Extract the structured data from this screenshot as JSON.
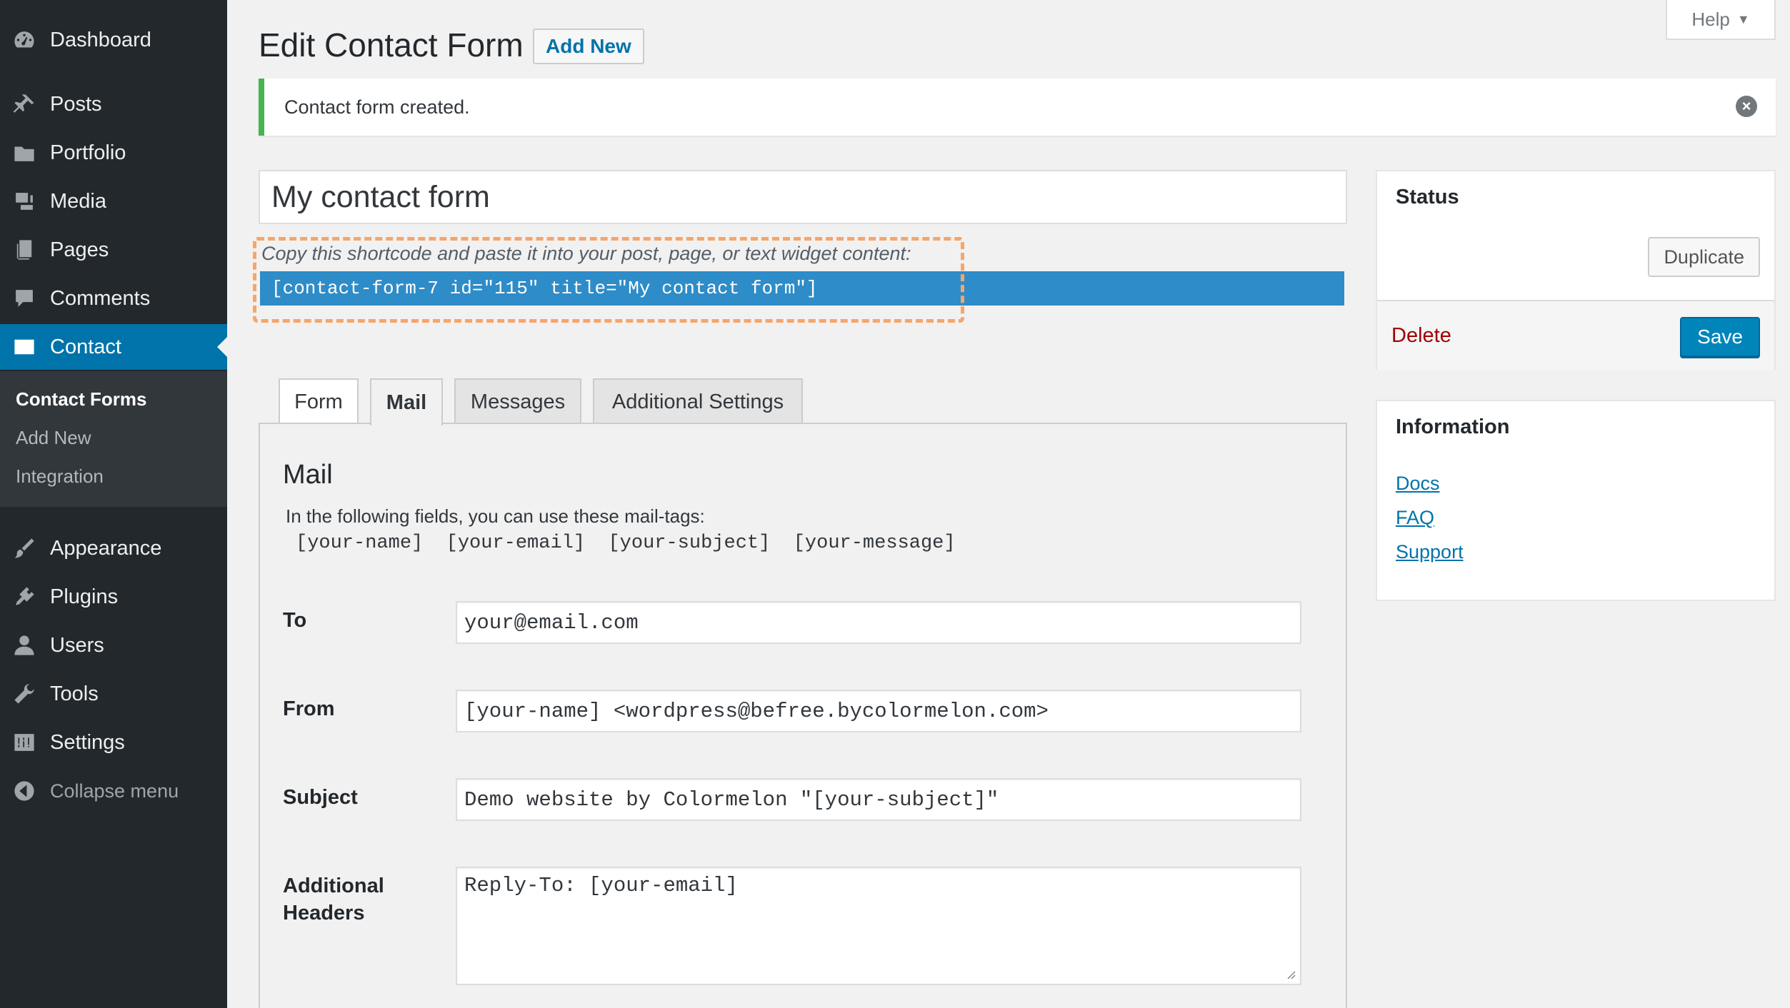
{
  "sidebar": {
    "items": [
      {
        "label": "Dashboard",
        "icon": "dashboard-icon"
      },
      {
        "label": "Posts",
        "icon": "pin-icon"
      },
      {
        "label": "Portfolio",
        "icon": "folder-icon"
      },
      {
        "label": "Media",
        "icon": "media-icon"
      },
      {
        "label": "Pages",
        "icon": "pages-icon"
      },
      {
        "label": "Comments",
        "icon": "comment-icon"
      },
      {
        "label": "Contact",
        "icon": "envelope-icon"
      },
      {
        "label": "Appearance",
        "icon": "paintbrush-icon"
      },
      {
        "label": "Plugins",
        "icon": "plugin-icon"
      },
      {
        "label": "Users",
        "icon": "user-icon"
      },
      {
        "label": "Tools",
        "icon": "wrench-icon"
      },
      {
        "label": "Settings",
        "icon": "settings-icon"
      }
    ],
    "submenu": [
      "Contact Forms",
      "Add New",
      "Integration"
    ],
    "collapse_label": "Collapse menu"
  },
  "header": {
    "title": "Edit Contact Form",
    "add_new_label": "Add New",
    "help_label": "Help"
  },
  "notice": {
    "text": "Contact form created."
  },
  "form": {
    "title_value": "My contact form",
    "shortcode_hint": "Copy this shortcode and paste it into your post, page, or text widget content:",
    "shortcode": "[contact-form-7 id=\"115\" title=\"My contact form\"]"
  },
  "tabs": [
    "Form",
    "Mail",
    "Messages",
    "Additional Settings"
  ],
  "active_tab": "Mail",
  "mail": {
    "heading": "Mail",
    "intro": "In the following fields, you can use these mail-tags:",
    "tags": "[your-name]  [your-email]  [your-subject]  [your-message]",
    "fields": {
      "to": {
        "label": "To",
        "value": "your@email.com"
      },
      "from": {
        "label": "From",
        "value": "[your-name] <wordpress@befree.bycolormelon.com>"
      },
      "subject": {
        "label": "Subject",
        "value": "Demo website by Colormelon \"[your-subject]\""
      },
      "headers": {
        "label": "Additional Headers",
        "value": "Reply-To: [your-email]"
      }
    }
  },
  "status_box": {
    "title": "Status",
    "duplicate_label": "Duplicate",
    "delete_label": "Delete",
    "save_label": "Save"
  },
  "info_box": {
    "title": "Information",
    "links": [
      "Docs",
      "FAQ",
      "Support"
    ]
  },
  "colors": {
    "sidebar_bg": "#23282d",
    "accent": "#0073aa",
    "notice_success": "#46b450",
    "shortcode_bg": "#2e8cc8",
    "delete": "#a00000",
    "highlight": "#f5a66a"
  }
}
